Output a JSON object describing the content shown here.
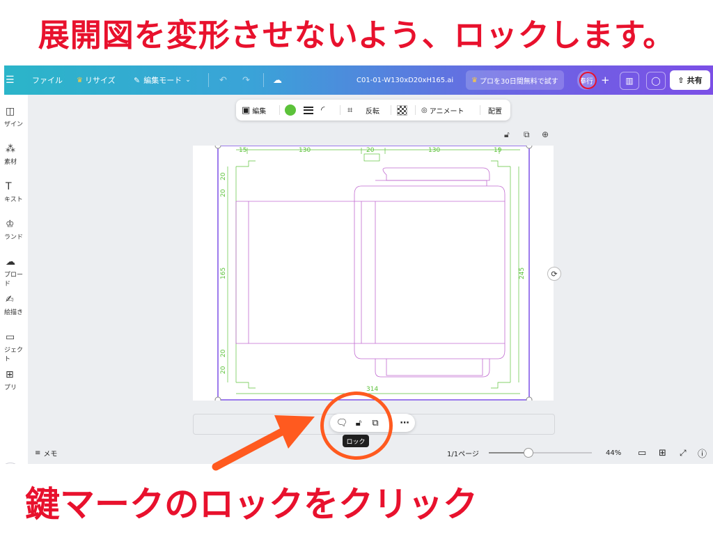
{
  "heading": "展開図を変形させないよう、ロックします。",
  "caption": "鍵マークのロックをクリック",
  "topbar": {
    "menu_icon": "hamburger-icon",
    "file": "ファイル",
    "resize": "リサイズ",
    "edit_mode": "編集モード",
    "filename": "C01-01-W130xD20xH165.ai",
    "pro_trial": "プロを30日間無料で試す",
    "avatar": "奉行",
    "share": "共有"
  },
  "sidebar": {
    "items": [
      {
        "icon": "layout-icon",
        "label": "ザイン"
      },
      {
        "icon": "elements-icon",
        "label": "素材"
      },
      {
        "icon": "text-icon",
        "label": "キスト"
      },
      {
        "icon": "brand-icon",
        "label": "ランド"
      },
      {
        "icon": "upload-icon",
        "label": "プロード"
      },
      {
        "icon": "draw-icon",
        "label": "絵描き"
      },
      {
        "icon": "folder-icon",
        "label": "ジェクト"
      },
      {
        "icon": "apps-icon",
        "label": "プリ"
      }
    ]
  },
  "context_toolbar": {
    "edit": "編集",
    "flip": "反転",
    "animate": "アニメート",
    "arrange": "配置",
    "color": "#5cc23a"
  },
  "dieline": {
    "top_dims": [
      "15",
      "130",
      "20",
      "130",
      "19"
    ],
    "left_dims": [
      "20",
      "20",
      "165",
      "20",
      "20"
    ],
    "right_dim": "245",
    "bottom_dim": "314",
    "stroke_colors": {
      "frame": "#7b4fe6",
      "green": "#5cc23a",
      "magenta": "#c06ad0"
    }
  },
  "tooltip": "ロック",
  "bottombar": {
    "notes": "メモ",
    "page": "1/1ページ",
    "zoom": "44%",
    "zoom_fraction": 0.38
  }
}
